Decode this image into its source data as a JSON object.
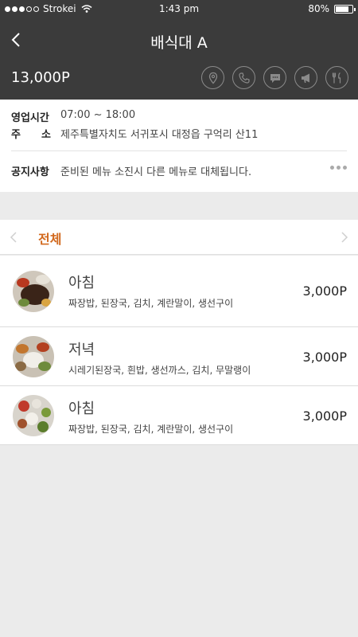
{
  "status_bar": {
    "carrier": "Strokei",
    "time": "1:43 pm",
    "battery": "80%",
    "battery_level": 0.8
  },
  "header": {
    "title": "배식대 A",
    "price": "13,000P"
  },
  "action_icons": [
    {
      "name": "location-icon"
    },
    {
      "name": "phone-icon"
    },
    {
      "name": "chat-icon"
    },
    {
      "name": "megaphone-icon"
    },
    {
      "name": "utensils-icon"
    }
  ],
  "info": {
    "hours_label": "영업시간",
    "hours_value": "07:00 ~ 18:00",
    "address_label": "주　　소",
    "address_value": "제주특별자치도 서귀포시 대정읍 구억리 산11",
    "notice_label": "공지사항",
    "notice_value": "준비된 메뉴 소진시 다른 메뉴로 대체됩니다."
  },
  "tabs": {
    "active": "전체"
  },
  "menu": [
    {
      "name": "아침",
      "desc": "짜장밥, 된장국, 김치, 계란말이, 생선구이",
      "price": "3,000P"
    },
    {
      "name": "저녁",
      "desc": "시레기된장국, 흰밥, 생선까스, 김치, 무말랭이",
      "price": "3,000P"
    },
    {
      "name": "아침",
      "desc": "짜장밥, 된장국, 김치, 계란말이, 생선구이",
      "price": "3,000P"
    }
  ],
  "colors": {
    "header_bg": "#3b3b3b",
    "accent": "#d2691e",
    "page_bg": "#ebebeb"
  }
}
